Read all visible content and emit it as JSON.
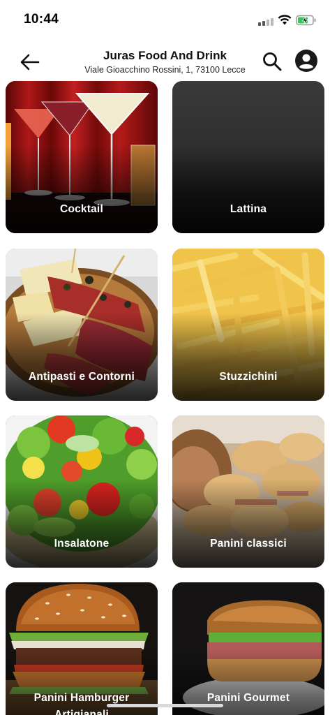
{
  "status_bar": {
    "time": "10:44",
    "icons": [
      "signal-icon",
      "wifi-icon",
      "battery-charging-icon"
    ]
  },
  "header": {
    "title": "Juras Food And Drink",
    "address": "Viale Gioacchino Rossini, 1, 73100 Lecce",
    "icons": [
      "back-arrow-icon",
      "search-icon",
      "profile-icon"
    ]
  },
  "categories": [
    {
      "label": "Cocktail"
    },
    {
      "label": "Lattina"
    },
    {
      "label": "Antipasti e Contorni"
    },
    {
      "label": "Stuzzichini"
    },
    {
      "label": "Insalatone"
    },
    {
      "label": "Panini classici"
    },
    {
      "label": "Panini Hamburger Artigianali"
    },
    {
      "label": "Panini Gourmet"
    }
  ],
  "colors": {
    "background": "#ffffff",
    "text": "#111111",
    "card_label": "#ffffff"
  }
}
